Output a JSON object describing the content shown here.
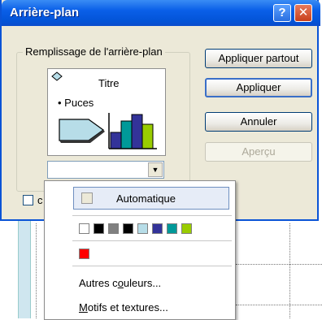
{
  "dialog": {
    "title": "Arrière-plan",
    "help_label": "?",
    "close_label": "✕"
  },
  "fill_group": {
    "label": "Remplissage de l'arrière-plan"
  },
  "preview": {
    "title": "Titre",
    "bullet": "• Puces"
  },
  "buttons": {
    "apply_all": "Appliquer partout",
    "apply": "Appliquer",
    "cancel": "Annuler",
    "preview": "Aperçu"
  },
  "checkbox_label": "c",
  "dropdown": {
    "automatic": "Automatique",
    "swatches": [
      "#ffffff",
      "#000000",
      "#808080",
      "#000000",
      "#b7dde8",
      "#333399",
      "#009999",
      "#99cc00"
    ],
    "recent_swatches": [
      "#ff0000"
    ],
    "more_colors_pre": "Autres c",
    "more_colors_u": "o",
    "more_colors_post": "uleurs...",
    "patterns_pre": "",
    "patterns_u": "M",
    "patterns_post": "otifs et textures..."
  }
}
